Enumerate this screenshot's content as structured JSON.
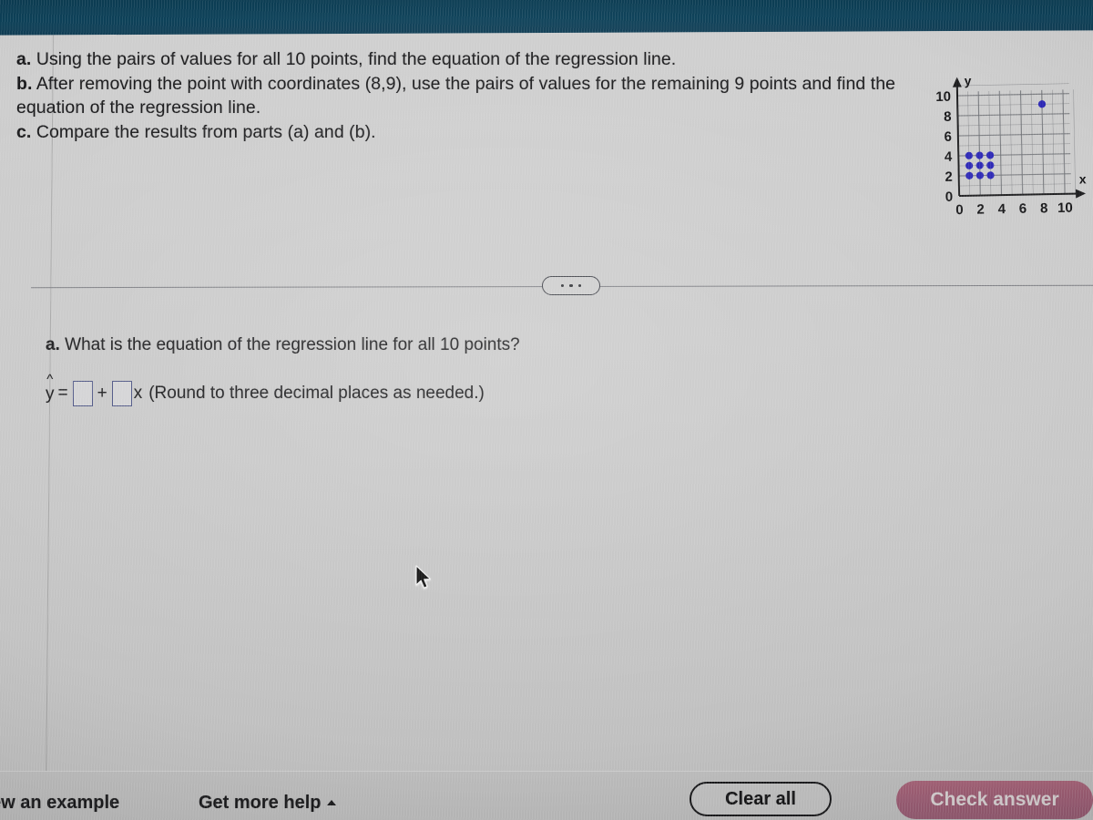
{
  "header": {
    "bar_color": "#0d4159"
  },
  "prompt": {
    "line_a_label": "a.",
    "line_a": " Using the pairs of values for all 10 points, find the equation of the regression line.",
    "line_b_label": "b.",
    "line_b": " After removing the point with coordinates (8,9), use the pairs of values for the remaining 9 points and find the equation of the regression line.",
    "line_c_label": "c.",
    "line_c": " Compare the results from parts (a) and (b)."
  },
  "chart_data": {
    "type": "scatter",
    "title": "",
    "xlabel": "x",
    "ylabel": "y",
    "xlim": [
      0,
      11
    ],
    "ylim": [
      0,
      11
    ],
    "xticks": [
      0,
      2,
      4,
      6,
      8,
      10
    ],
    "yticks": [
      0,
      2,
      4,
      6,
      8,
      10
    ],
    "grid": true,
    "grid_step": 1,
    "point_color": "#2b26b5",
    "series": [
      {
        "name": "data",
        "points": [
          [
            1,
            2
          ],
          [
            2,
            2
          ],
          [
            3,
            2
          ],
          [
            1,
            3
          ],
          [
            2,
            3
          ],
          [
            3,
            3
          ],
          [
            1,
            4
          ],
          [
            2,
            4
          ],
          [
            3,
            4
          ],
          [
            8,
            9
          ]
        ]
      }
    ]
  },
  "divider": {
    "ellipsis_label": "…"
  },
  "answer": {
    "part_label": "a.",
    "question": " What is the equation of the regression line for all 10 points?",
    "y_hat_symbol": "y",
    "hat_symbol": "^",
    "equals": "=",
    "plus": "+",
    "x_variable": "x",
    "intercept_value": "",
    "intercept_placeholder": "",
    "slope_value": "",
    "slope_placeholder": "",
    "rounding_note": "(Round to three decimal places as needed.)"
  },
  "toolbar": {
    "view_example_label": "ew an example",
    "get_more_help_label": "Get more help",
    "clear_all_label": "Clear all",
    "check_answer_label": "Check answer",
    "check_answer_color": "#96506a"
  }
}
